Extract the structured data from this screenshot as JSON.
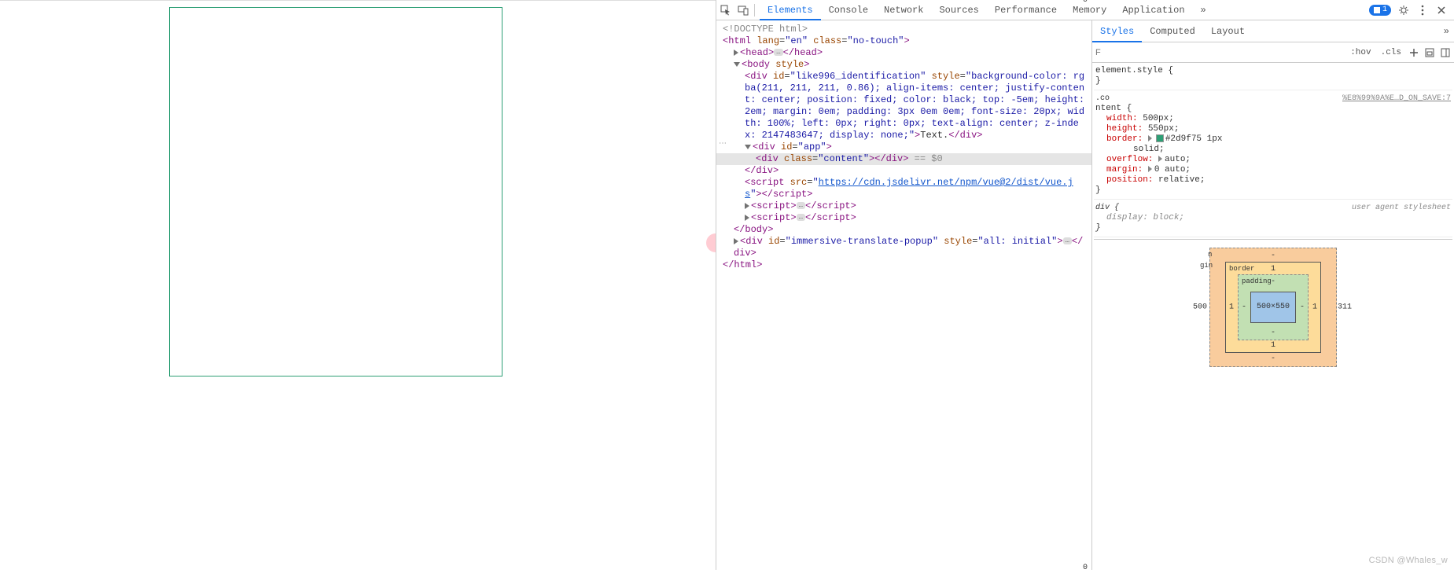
{
  "devtools": {
    "tabs": [
      "Elements",
      "Console",
      "Network",
      "Sources",
      "Performance",
      "Memory",
      "Application"
    ],
    "active_tab": "Elements",
    "more": "»",
    "issue_count": "1",
    "styles_tabs": [
      "Styles",
      "Computed",
      "Layout"
    ],
    "styles_active": "Styles",
    "filter_placeholder": "F",
    "hov": ":hov",
    "cls": ".cls"
  },
  "dom": {
    "doctype": "<!DOCTYPE html>",
    "html_open": "<html lang=\"en\" class=\"no-touch\">",
    "head_open": "<head>",
    "head_close": "</head>",
    "body_open": "<body style>",
    "div_identification": "<div id=\"like996_identification\" style=\"background-color: rgba(211, 211, 211, 0.86); align-items: center; justify-content: center; position: fixed; color: black; top: -5em; height: 2em; margin: 0em; padding: 3px 0em 0em; font-size: 20px; width: 100%; left: 0px; right: 0px; text-align: center; z-index: 2147483647; display: none;\">Text.</div>",
    "div_app_open": "<div id=\"app\">",
    "div_content": "<div class=\"content\"></div>",
    "selected_suffix": " == $0",
    "div_app_close": "</div>",
    "script_vue": "<script src=\"https://cdn.jsdelivr.net/npm/vue@2/dist/vue.js\"></script>",
    "script1_open": "<script>",
    "script1_close": "</script>",
    "script2_open": "<script>",
    "script2_close": "</script>",
    "body_close": "</body>",
    "div_popup": "<div id=\"immersive-translate-popup\" style=\"all: initial\">…</div>",
    "html_close": "</html>"
  },
  "styles": {
    "elem_style_sel": "element.style {",
    "close_brace": "}",
    "rule1_sel": ".co",
    "rule1_src": "%E8%99%9A%E…D_ON_SAVE:7",
    "rule1_pseudo": "ntent {",
    "rule1_props": {
      "width": "width:",
      "width_v": "500px;",
      "height": "height:",
      "height_v": "550px;",
      "border": "border:",
      "border_v": "#2d9f75 1px",
      "border_v2": "solid;",
      "overflow": "overflow:",
      "overflow_v": "auto;",
      "margin": "margin:",
      "margin_v": "0 auto;",
      "position": "position:",
      "position_v": "relative;"
    },
    "ua_sel": "div {",
    "ua_src": "user agent stylesheet",
    "ua_display": "display:",
    "ua_display_v": "block;"
  },
  "boxmodel": {
    "margin_label": "n",
    "margin_top": "-",
    "margin_right": "311",
    "margin_bottom": "-",
    "margin_left": "500",
    "border_label": "border",
    "border_top": "1",
    "border_right": "1",
    "border_bottom": "1",
    "border_left": "1",
    "padding_label": "padding",
    "padding_top": "-",
    "padding_right": "-",
    "padding_bottom": "-",
    "padding_left": "-",
    "content": "500×550",
    "outer_top": "0",
    "outer_bottom": "0",
    "gin": "gin"
  },
  "watermark": "CSDN @Whales_w"
}
